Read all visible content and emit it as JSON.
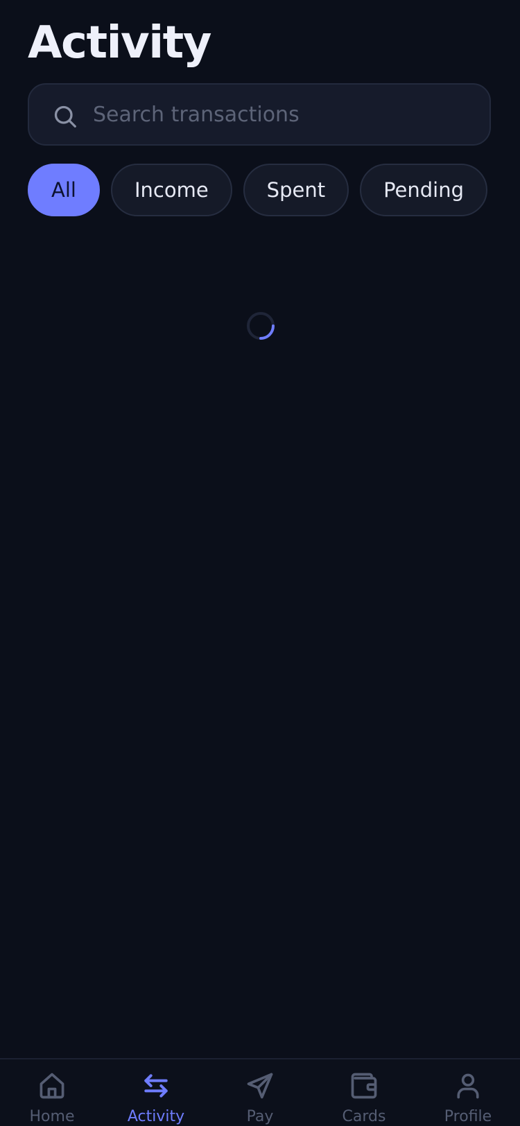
{
  "header": {
    "title": "Activity"
  },
  "search": {
    "placeholder": "Search transactions",
    "value": ""
  },
  "filters": [
    {
      "label": "All",
      "active": true
    },
    {
      "label": "Income",
      "active": false
    },
    {
      "label": "Spent",
      "active": false
    },
    {
      "label": "Pending",
      "active": false
    }
  ],
  "loading": true,
  "tabbar": {
    "items": [
      {
        "label": "Home",
        "icon": "home-icon",
        "active": false
      },
      {
        "label": "Activity",
        "icon": "transfer-arrows-icon",
        "active": true
      },
      {
        "label": "Pay",
        "icon": "send-icon",
        "active": false
      },
      {
        "label": "Cards",
        "icon": "wallet-icon",
        "active": false
      },
      {
        "label": "Profile",
        "icon": "user-icon",
        "active": false
      }
    ]
  },
  "colors": {
    "background": "#0b0f1a",
    "surface": "#161b2b",
    "accent": "#6f7dff",
    "text": "#eef0fa",
    "muted": "#555d73"
  }
}
